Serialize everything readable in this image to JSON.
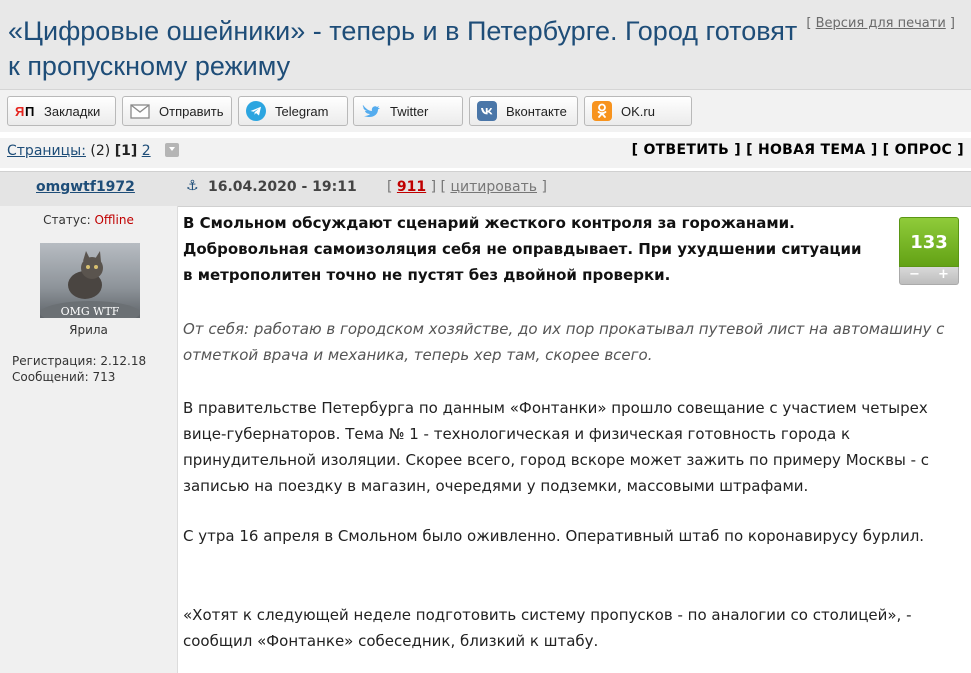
{
  "header": {
    "title": "«Цифровые ошейники» - теперь и в Петербурге. Город готовят к пропускному режиму",
    "print_prefix": "[ ",
    "print_label": "Версия для печати",
    "print_suffix": " ]"
  },
  "share": [
    {
      "label": "Закладки",
      "icon": "yandex-bookmarks-icon"
    },
    {
      "label": "Отправить",
      "icon": "mail-icon"
    },
    {
      "label": "Telegram",
      "icon": "telegram-icon"
    },
    {
      "label": "Twitter",
      "icon": "twitter-icon"
    },
    {
      "label": "Вконтакте",
      "icon": "vk-icon"
    },
    {
      "label": "OK.ru",
      "icon": "odnoklassniki-icon"
    }
  ],
  "pagination": {
    "label": "Страницы:",
    "total": "(2)",
    "current": "[1]",
    "next": "2"
  },
  "actions": {
    "reply": "ОТВЕТИТЬ",
    "new_topic": "НОВАЯ ТЕМА",
    "poll": "ОПРОС"
  },
  "post": {
    "author": "omgwtf1972",
    "anchor_glyph": "⚓",
    "date": "16.04.2020 - 19:11",
    "number": "911",
    "quote_label": "цитировать",
    "status_label": "Статус:",
    "status_value": "Offline",
    "avatar_text": "OMG WTF",
    "nickname": "Ярила",
    "registration": "Регистрация: 2.12.18",
    "messages": "Сообщений: 713",
    "rating": "133",
    "rating_minus": "−",
    "rating_plus": "+",
    "paragraphs": [
      "В Смольном обсуждают сценарий жесткого контроля за горожанами. Добровольная самоизоляция себя не оправдывает. При ухудшении ситуации в метрополитен точно не пустят без двойной проверки.",
      "От себя: работаю в городском хозяйстве, до их пор прокатывал путевой лист на автомашину с отметкой врача и механика, теперь хер там, скорее всего.",
      "В правительстве Петербурга по данным «Фонтанки» прошло совещание с участием четырех вице-губернаторов. Тема № 1 - технологическая и физическая готовность города к принудительной изоляции. Скорее всего, город вскоре может зажить по примеру Москвы - с записью на поездку в магазин, очередями у подземки, массовыми штрафами.",
      "С утра 16 апреля в Смольном было оживленно. Оперативный штаб по коронавирусу бурлил.",
      "«Хотят к следующей неделе подготовить систему пропусков - по аналогии со столицей», - сообщил «Фонтанке» собеседник, близкий к штабу."
    ]
  },
  "colors": {
    "link": "#1e4d78",
    "rating_green": "#7bbd2a",
    "status_offline": "#c00000"
  }
}
